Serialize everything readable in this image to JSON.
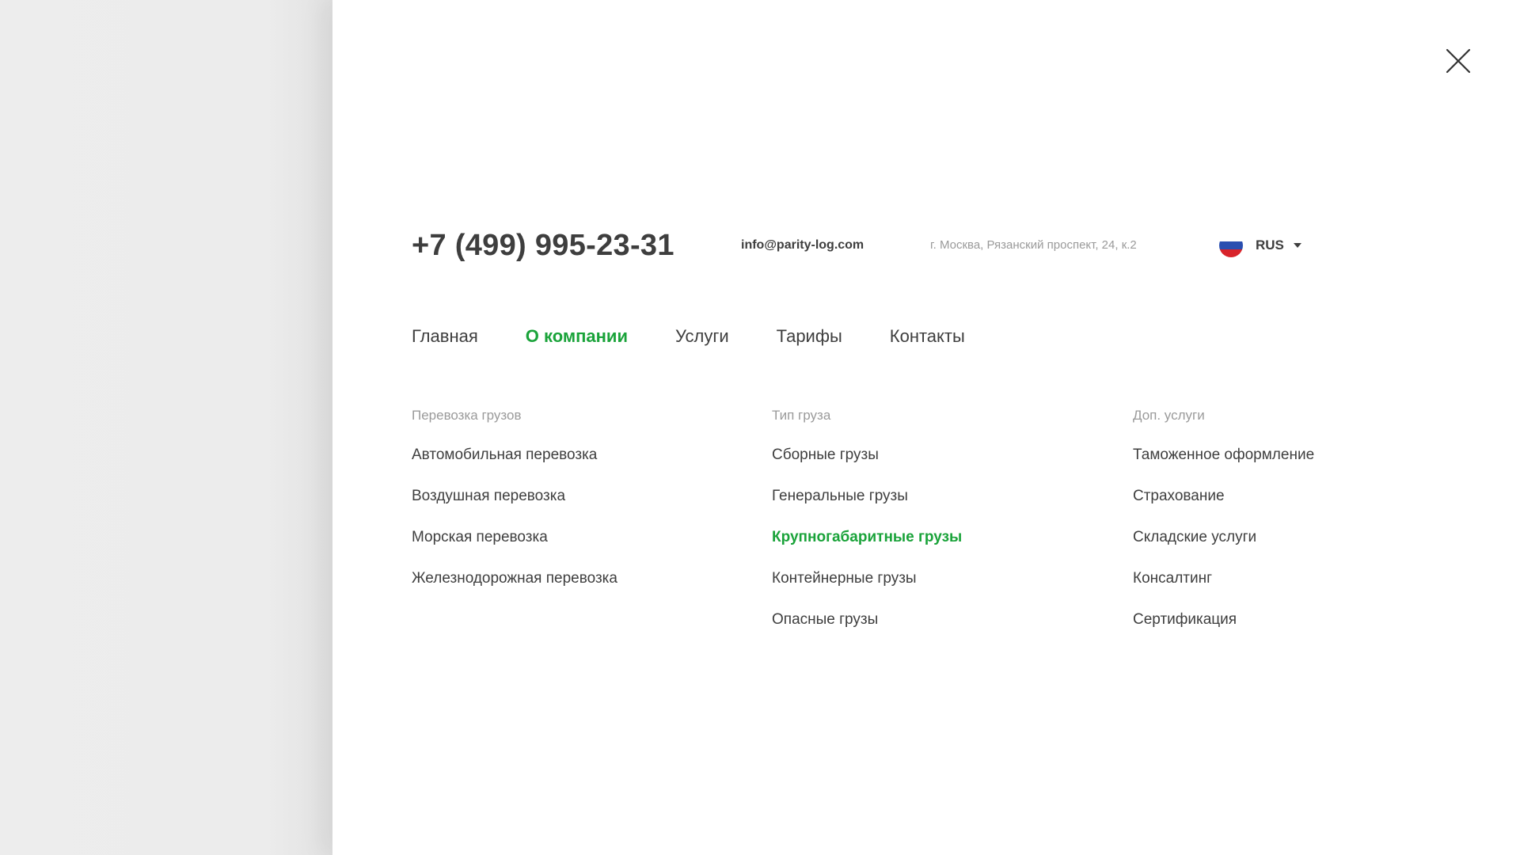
{
  "close": {
    "icon": "close-icon"
  },
  "contacts": {
    "phone": "+7 (499) 995-23-31",
    "email": "info@parity-log.com",
    "address": "г. Москва, Рязанский проспект, 24, к.2"
  },
  "language": {
    "label": "RUS",
    "flag_icon": "russia-flag-icon",
    "caret_icon": "caret-down-icon",
    "flag_colors": [
      "#ffffff",
      "#2a4fb0",
      "#d8232a"
    ]
  },
  "nav": {
    "items": [
      {
        "label": "Главная",
        "active": false
      },
      {
        "label": "О компании",
        "active": true
      },
      {
        "label": "Услуги",
        "active": false
      },
      {
        "label": "Тарифы",
        "active": false
      },
      {
        "label": "Контакты",
        "active": false
      }
    ]
  },
  "columns": [
    {
      "heading": "Перевозка грузов",
      "items": [
        {
          "label": "Автомобильная перевозка",
          "active": false
        },
        {
          "label": "Воздушная перевозка",
          "active": false
        },
        {
          "label": "Морская перевозка",
          "active": false
        },
        {
          "label": "Железнодорожная перевозка",
          "active": false
        }
      ]
    },
    {
      "heading": "Тип груза",
      "items": [
        {
          "label": "Сборные грузы",
          "active": false
        },
        {
          "label": "Генеральные грузы",
          "active": false
        },
        {
          "label": "Крупногабаритные грузы",
          "active": true
        },
        {
          "label": "Контейнерные грузы",
          "active": false
        },
        {
          "label": "Опасные грузы",
          "active": false
        }
      ]
    },
    {
      "heading": "Доп. услуги",
      "items": [
        {
          "label": "Таможенное оформление",
          "active": false
        },
        {
          "label": "Страхование",
          "active": false
        },
        {
          "label": "Складские услуги",
          "active": false
        },
        {
          "label": "Консалтинг",
          "active": false
        },
        {
          "label": "Сертификация",
          "active": false
        }
      ]
    }
  ],
  "colors": {
    "accent": "#1aa33a",
    "text": "#3e3e3e",
    "muted": "#9a9a9a",
    "backdrop": "#ececec",
    "panel": "#ffffff"
  }
}
